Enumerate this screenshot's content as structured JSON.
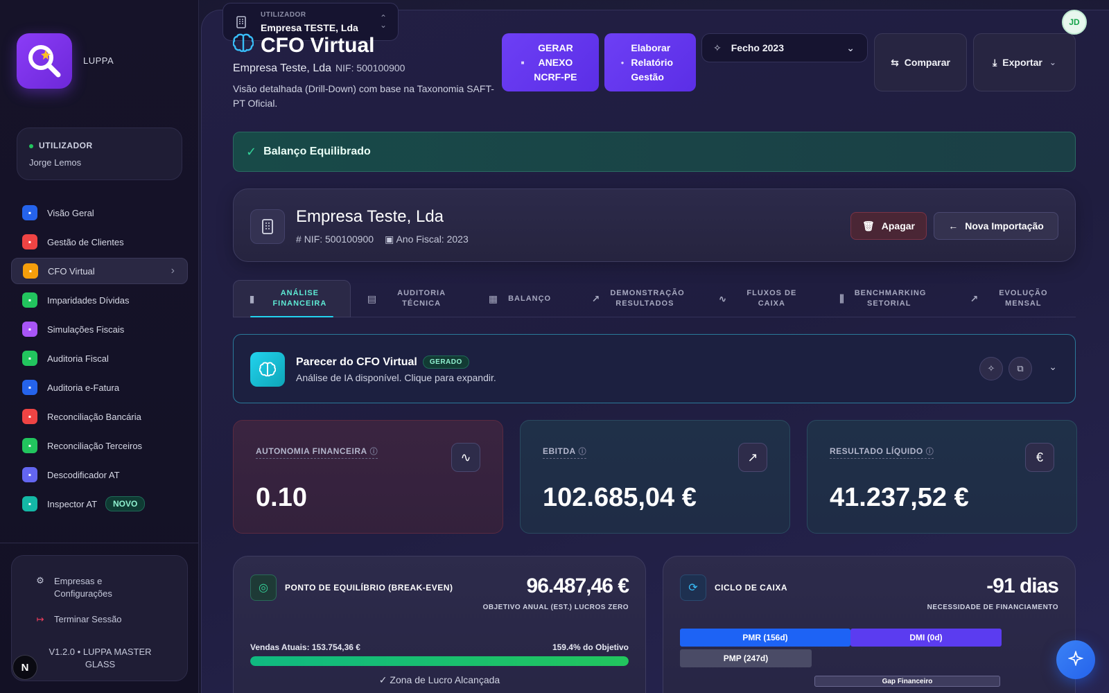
{
  "app": {
    "name": "LUPPA"
  },
  "user_card": {
    "role": "UTILIZADOR",
    "name": "Jorge Lemos"
  },
  "nav": [
    {
      "label": "Visão Geral",
      "icon": "grid-icon",
      "color": "#2563eb"
    },
    {
      "label": "Gestão de Clientes",
      "icon": "building-icon",
      "color": "#ef4444"
    },
    {
      "label": "CFO Virtual",
      "icon": "brain-icon",
      "color": "#f59e0b",
      "active": true
    },
    {
      "label": "Imparidades Dívidas",
      "icon": "scale-icon",
      "color": "#22c55e"
    },
    {
      "label": "Simulações Fiscais",
      "icon": "calculator-icon",
      "color": "#a855f7"
    },
    {
      "label": "Auditoria Fiscal",
      "icon": "document-icon",
      "color": "#22c55e"
    },
    {
      "label": "Auditoria e-Fatura",
      "icon": "receipt-icon",
      "color": "#2563eb"
    },
    {
      "label": "Reconciliação Bancária",
      "icon": "swap-icon",
      "color": "#ef4444"
    },
    {
      "label": "Reconciliação Terceiros",
      "icon": "users-icon",
      "color": "#22c55e"
    },
    {
      "label": "Descodificador AT",
      "icon": "scale-icon",
      "color": "#6366f1"
    },
    {
      "label": "Inspector AT",
      "icon": "shield-icon",
      "color": "#14b8a6",
      "badge": "NOVO"
    }
  ],
  "settings": {
    "companies_label": "Empresas e Configurações",
    "logout_label": "Terminar Sessão",
    "version": "V1.2.0 • LUPPA MASTER GLASS"
  },
  "bubble": "N",
  "header": {
    "switch_label": "UTILIZADOR",
    "switch_value": "Empresa TESTE, Lda",
    "title": "CFO Virtual",
    "company": "Empresa Teste, Lda",
    "nif": "NIF: 500100900",
    "description": "Visão detalhada (Drill-Down) com base na Taxonomia SAFT-PT Oficial.",
    "btn_anexo": "GERAR ANEXO NCRF-PE",
    "btn_relatorio": "Elaborar Relatório Gestão",
    "period": "Fecho 2023",
    "btn_compare": "Comparar",
    "btn_export": "Exportar",
    "avatar": "JD"
  },
  "alert": {
    "text": "Balanço Equilibrado"
  },
  "company_card": {
    "name": "Empresa Teste, Lda",
    "nif": "NIF: 500100900",
    "year": "Ano Fiscal: 2023",
    "btn_delete": "Apagar",
    "btn_import": "Nova Importação"
  },
  "tabs": [
    {
      "label": "ANÁLISE FINANCEIRA",
      "icon": "bar-chart-icon",
      "active": true
    },
    {
      "label": "AUDITORIA TÉCNICA",
      "icon": "document-icon"
    },
    {
      "label": "BALANÇO",
      "icon": "building-icon"
    },
    {
      "label": "DEMONSTRAÇÃO RESULTADOS",
      "icon": "trend-up-icon"
    },
    {
      "label": "FLUXOS DE CAIXA",
      "icon": "pulse-icon"
    },
    {
      "label": "BENCHMARKING SETORIAL",
      "icon": "bars-icon"
    },
    {
      "label": "EVOLUÇÃO MENSAL",
      "icon": "trend-up-icon"
    }
  ],
  "cfo_opinion": {
    "title": "Parecer do CFO Virtual",
    "badge": "GERADO",
    "subtitle": "Análise de IA disponível. Clique para expandir."
  },
  "kpis": [
    {
      "label": "AUTONOMIA FINANCEIRA",
      "value": "0.10",
      "icon": "pulse-icon",
      "tone": "red"
    },
    {
      "label": "EBITDA",
      "value": "102.685,04 €",
      "icon": "trend-up-icon",
      "tone": "teal"
    },
    {
      "label": "RESULTADO LÍQUIDO",
      "value": "41.237,52 €",
      "icon": "euro-icon",
      "tone": "teal"
    }
  ],
  "break_even": {
    "title": "PONTO DE EQUILÍBRIO (BREAK-EVEN)",
    "value": "96.487,46 €",
    "caption": "OBJETIVO ANUAL (EST.) LUCROS ZERO",
    "sales": "Vendas Atuais: 153.754,36 €",
    "percent_label": "159.4% do Objetivo",
    "progress": 1.0,
    "zone": "Zona de Lucro Alcançada"
  },
  "cash_cycle": {
    "title": "CICLO DE CAIXA",
    "value": "-91 dias",
    "caption": "NECESSIDADE DE FINANCIAMENTO",
    "pmr": "PMR (156d)",
    "dmi": "DMI (0d)",
    "pmp": "PMP (247d)",
    "gap": "Gap Financeiro"
  }
}
